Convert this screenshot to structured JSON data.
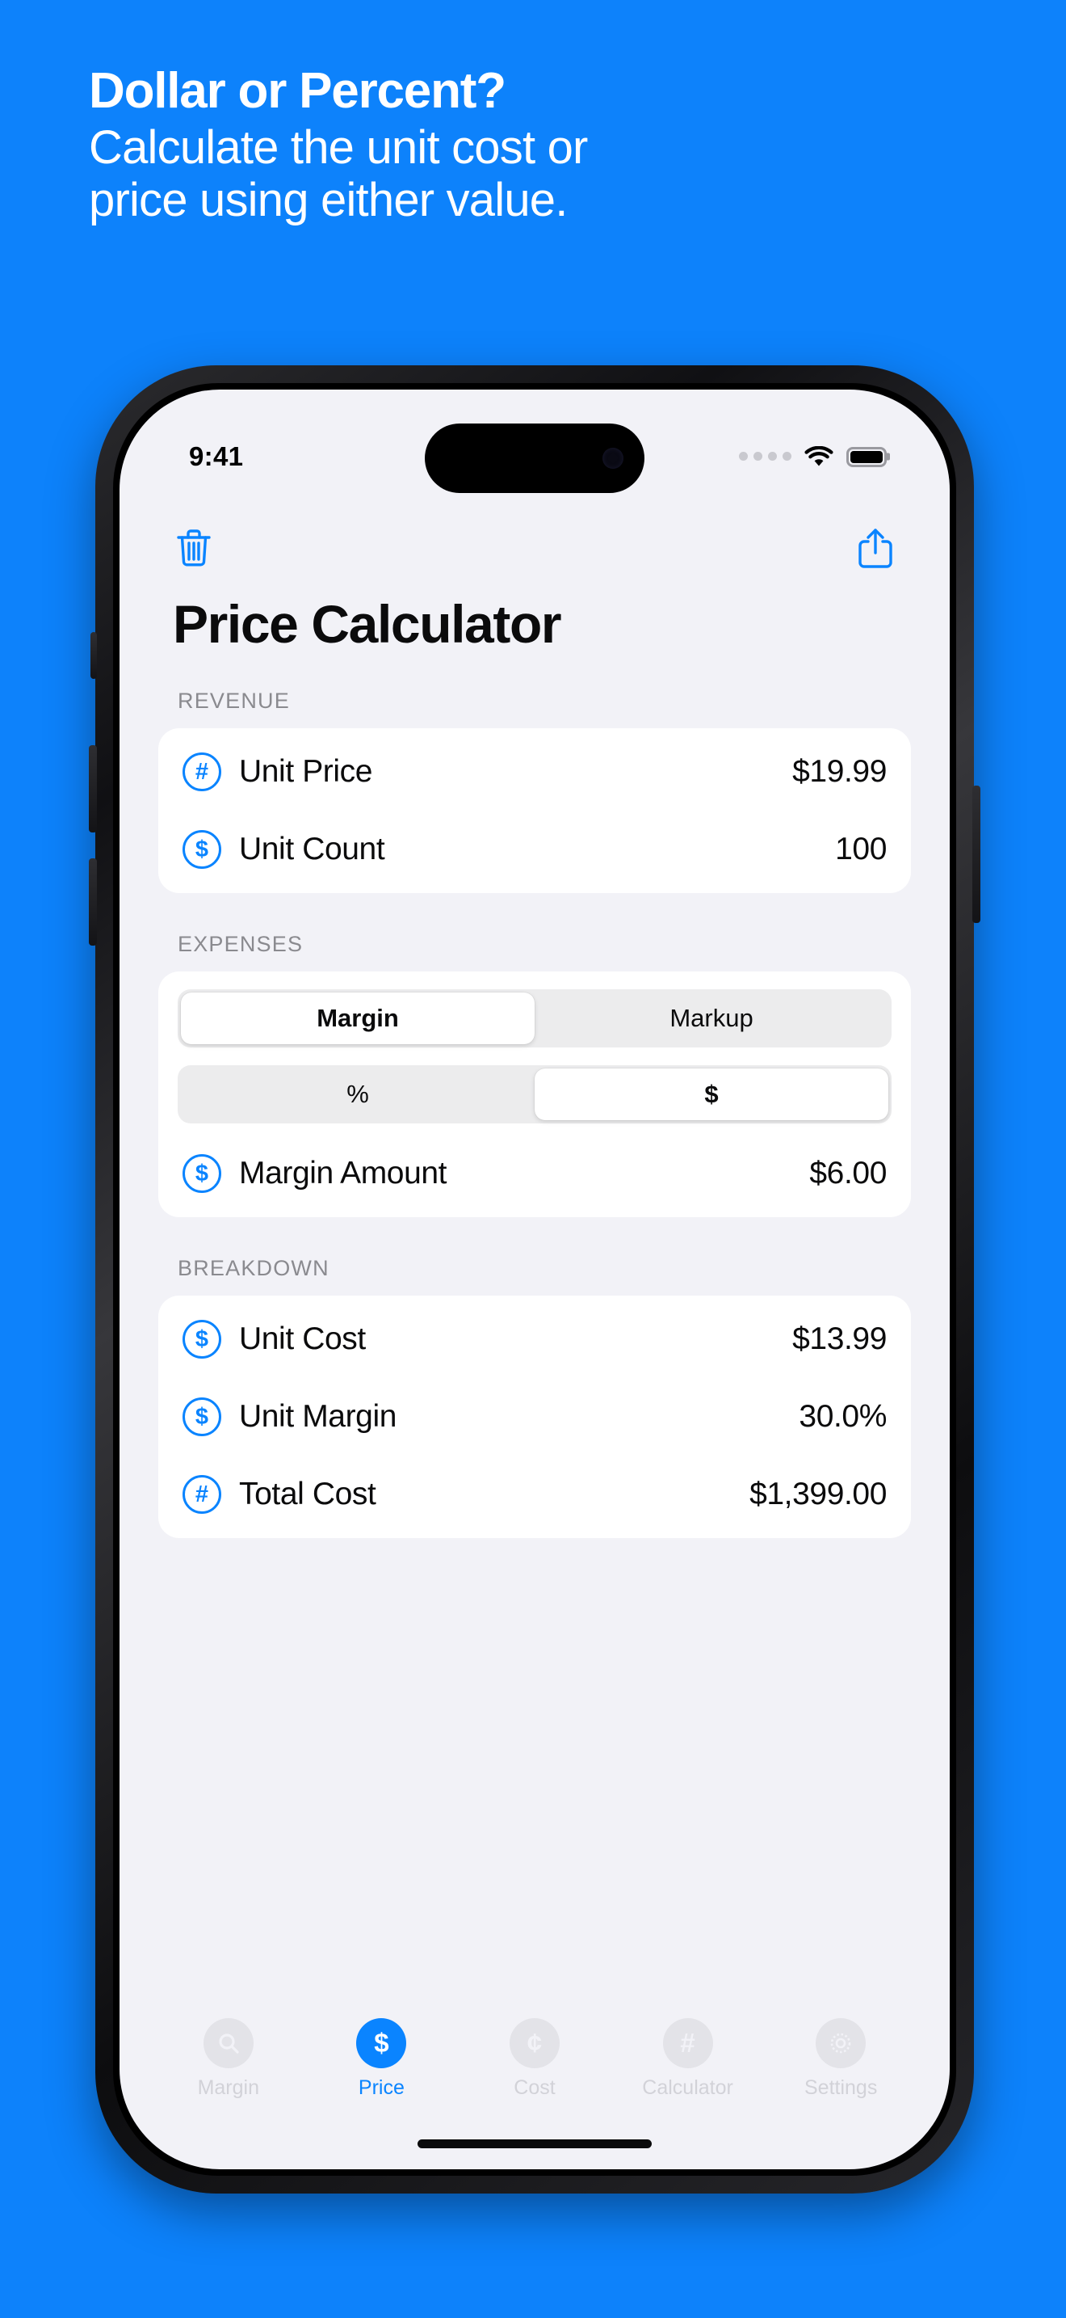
{
  "promo": {
    "background_color": "#0d82fb",
    "headline": "Dollar or Percent?",
    "subhead_line1": "Calculate the unit cost or",
    "subhead_line2": "price using either value."
  },
  "accent_color": "#0a84ff",
  "status_bar": {
    "time": "9:41",
    "signal_icon": "signal-dots-icon",
    "wifi_icon": "wifi-icon",
    "battery_icon": "battery-full-icon"
  },
  "toolbar": {
    "delete_icon": "trash-icon",
    "share_icon": "share-icon"
  },
  "page_title": "Price Calculator",
  "sections": [
    {
      "title": "REVENUE",
      "rows": [
        {
          "icon": "#",
          "icon_name": "hash-badge-icon",
          "label": "Unit Price",
          "value": "$19.99"
        },
        {
          "icon": "$",
          "icon_name": "dollar-badge-icon",
          "label": "Unit Count",
          "value": "100"
        }
      ]
    },
    {
      "title": "EXPENSES",
      "segments": [
        {
          "name": "margin-markup-segmented",
          "options": [
            "Margin",
            "Markup"
          ],
          "selected": "Margin"
        },
        {
          "name": "percent-dollar-segmented",
          "options": [
            "%",
            "$"
          ],
          "selected": "$"
        }
      ],
      "rows": [
        {
          "icon": "$",
          "icon_name": "dollar-badge-icon",
          "label": "Margin Amount",
          "value": "$6.00"
        }
      ]
    },
    {
      "title": "BREAKDOWN",
      "rows": [
        {
          "icon": "$",
          "icon_name": "dollar-badge-icon",
          "label": "Unit Cost",
          "value": "$13.99"
        },
        {
          "icon": "$",
          "icon_name": "dollar-badge-icon",
          "label": "Unit Margin",
          "value": "30.0%"
        },
        {
          "icon": "#",
          "icon_name": "hash-badge-icon",
          "label": "Total Cost",
          "value": "$1,399.00"
        }
      ]
    }
  ],
  "tabbar": {
    "items": [
      {
        "label": "Margin",
        "icon_name": "magnifier-icon",
        "glyph": "",
        "active": false
      },
      {
        "label": "Price",
        "icon_name": "dollar-icon",
        "glyph": "$",
        "active": true
      },
      {
        "label": "Cost",
        "icon_name": "cent-icon",
        "glyph": "¢",
        "active": false
      },
      {
        "label": "Calculator",
        "icon_name": "hash-icon",
        "glyph": "#",
        "active": false
      },
      {
        "label": "Settings",
        "icon_name": "gear-icon",
        "glyph": "",
        "active": false
      }
    ]
  }
}
